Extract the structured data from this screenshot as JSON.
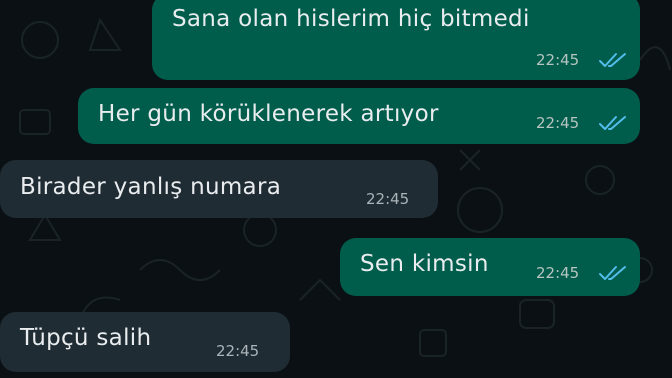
{
  "messages": [
    {
      "direction": "outgoing",
      "text": "Sana olan hislerim hiç bitmedi",
      "time": "22:45",
      "status": "read"
    },
    {
      "direction": "outgoing",
      "text": "Her gün körüklenerek artıyor",
      "time": "22:45",
      "status": "read"
    },
    {
      "direction": "incoming",
      "text": "Birader yanlış numara",
      "time": "22:45"
    },
    {
      "direction": "outgoing",
      "text": "Sen kimsin",
      "time": "22:45",
      "status": "read"
    },
    {
      "direction": "incoming",
      "text": "Tüpçü salih",
      "time": "22:45"
    }
  ],
  "colors": {
    "background": "#0b1014",
    "outgoing_bubble": "#005c4b",
    "incoming_bubble": "#202c33",
    "read_ticks": "#53bdeb"
  },
  "icons": {
    "read_receipt": "double-check-icon"
  }
}
